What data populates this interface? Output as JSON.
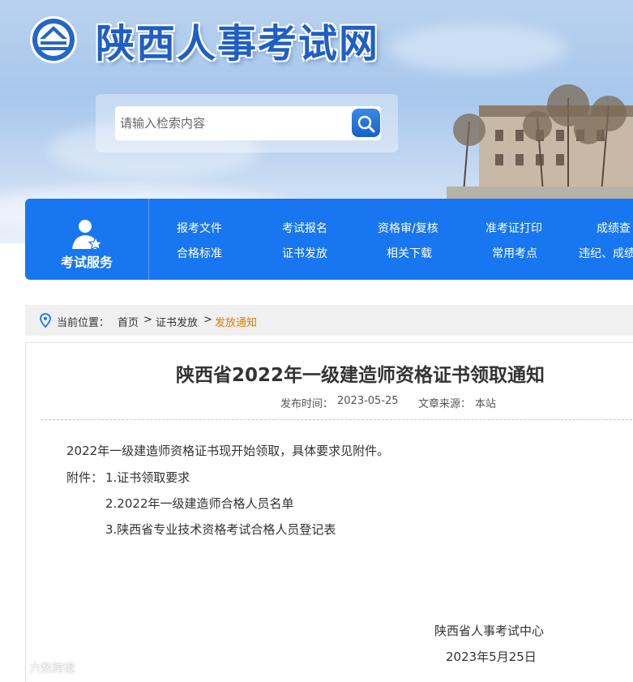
{
  "header": {
    "site_title": "陕西人事考试网",
    "search": {
      "placeholder": "请输入检索内容",
      "icon": "search-icon"
    }
  },
  "nav": {
    "service_label": "考试服务",
    "service_icon": "user-star-icon",
    "row1": [
      "报考文件",
      "考试报名",
      "资格审/复核",
      "准考证打印",
      "成绩查"
    ],
    "row2": [
      "合格标准",
      "证书发放",
      "相关下载",
      "常用考点",
      "违纪、成绩"
    ]
  },
  "breadcrumb": {
    "icon": "location-pin-icon",
    "prefix": "当前位置：",
    "items": [
      "首页",
      "证书发放",
      "发放通知"
    ],
    "separator": ">"
  },
  "article": {
    "title": "陕西省2022年一级建造师资格证书领取通知",
    "publish_label": "发布时间：",
    "publish_date": "2023-05-25",
    "source_label": "文章来源：",
    "source": "本站",
    "intro": "2022年一级建造师资格证书现开始领取，具体要求见附件。",
    "attachments_label": "附件：",
    "attachments": [
      "1.证书领取要求",
      "2.2022年一级建造师合格人员名单",
      "3.陕西省专业技术资格考试合格人员登记表"
    ],
    "signature_org": "陕西省人事考试中心",
    "signature_date": "2023年5月25日"
  },
  "watermark": "六数跨境",
  "colors": {
    "nav_blue": "#1877f0",
    "title_blue": "#1f5fc4",
    "breadcrumb_current": "#e07a00"
  }
}
